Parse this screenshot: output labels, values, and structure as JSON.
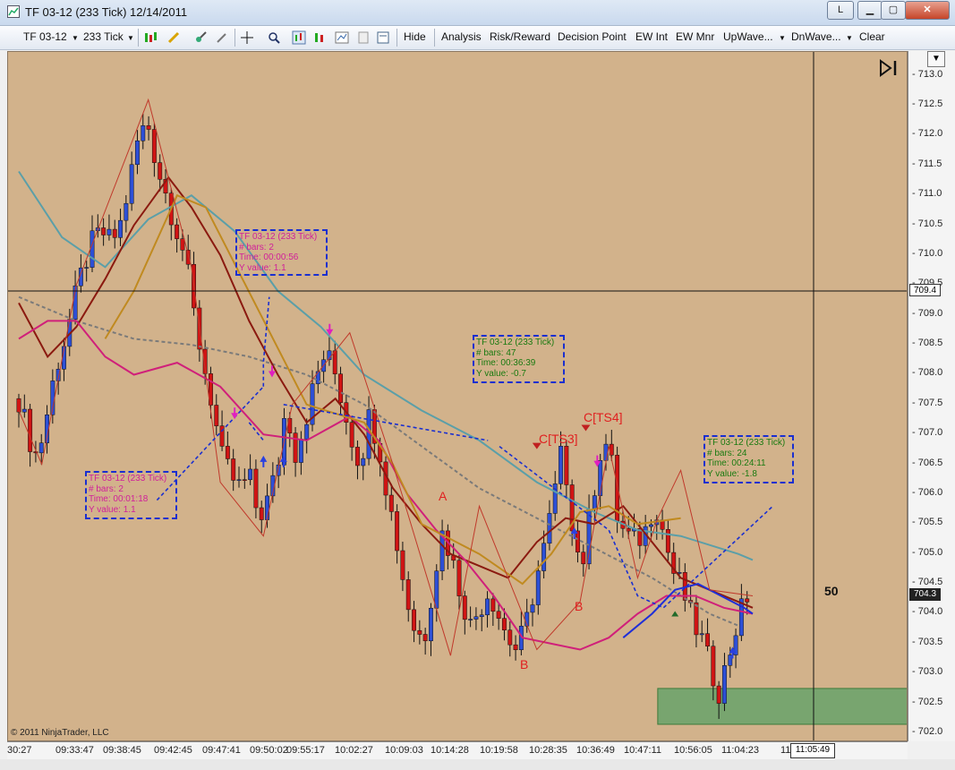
{
  "window": {
    "title": "TF 03-12 (233 Tick)  12/14/2011",
    "btn_l": "L"
  },
  "toolbar": {
    "instrument": "TF 03-12",
    "interval": "233 Tick",
    "items": [
      "Hide",
      "Analysis",
      "Risk/Reward",
      "Decision Point",
      "EW Int",
      "EW Mnr",
      "UpWave...",
      "DnWave...",
      "Clear"
    ]
  },
  "chart_data": {
    "type": "candlestick",
    "instrument": "TF 03-12 (233 Tick)",
    "date": "12/14/2011",
    "ylim": [
      701.85,
      713.4
    ],
    "y_ticks": [
      702.0,
      702.5,
      703.0,
      703.5,
      704.0,
      704.5,
      705.0,
      705.5,
      706.0,
      706.5,
      707.0,
      707.5,
      708.0,
      708.5,
      709.0,
      709.5,
      710.0,
      710.5,
      711.0,
      711.5,
      712.0,
      712.5,
      713.0
    ],
    "x_ticks": [
      "30:27",
      "09:33:47",
      "09:38:45",
      "09:42:45",
      "09:47:41",
      "09:50:02",
      "09:55:17",
      "10:02:27",
      "10:09:03",
      "10:14:28",
      "10:19:58",
      "10:28:35",
      "10:36:49",
      "10:47:11",
      "10:56:05",
      "11:04:23",
      "11:1"
    ],
    "close_path": [
      707.6,
      707.0,
      706.6,
      707.3,
      708.1,
      708.6,
      709.2,
      709.8,
      710.2,
      710.4,
      710.2,
      710.5,
      711.2,
      712.0,
      712.2,
      711.5,
      711.0,
      710.5,
      710.0,
      709.0,
      708.2,
      707.5,
      706.6,
      706.3,
      706.1,
      706.3,
      705.6,
      705.9,
      706.4,
      707.5,
      706.7,
      707.2,
      707.8,
      708.3,
      708.2,
      707.6,
      707.0,
      706.5,
      707.3,
      706.9,
      706.0,
      705.2,
      704.3,
      703.7,
      703.6,
      704.6,
      705.4,
      704.9,
      704.3,
      703.8,
      704.1,
      704.4,
      704.0,
      703.6,
      703.4,
      703.8,
      704.5,
      705.1,
      705.9,
      706.8,
      705.6,
      704.7,
      705.7,
      706.7,
      706.9,
      705.5,
      705.3,
      705.2,
      705.4,
      705.9,
      705.3,
      704.7,
      704.4,
      703.9,
      703.6,
      703.1,
      702.7,
      703.3,
      703.9,
      704.3
    ],
    "n_bars": 130,
    "last_price": "704.3",
    "crosshair_price": "709.4",
    "crosshair_time": "11:05:49",
    "crosshair_price_value": 709.4,
    "moving_averages": [
      {
        "color": "#5b9fa8",
        "points": [
          [
            0,
            711.4
          ],
          [
            15,
            710.3
          ],
          [
            30,
            709.8
          ],
          [
            45,
            710.6
          ],
          [
            60,
            711.0
          ],
          [
            75,
            710.4
          ],
          [
            90,
            709.4
          ],
          [
            105,
            708.8
          ],
          [
            120,
            708.0
          ],
          [
            140,
            707.4
          ],
          [
            160,
            706.9
          ],
          [
            180,
            706.2
          ],
          [
            200,
            705.7
          ],
          [
            215,
            705.4
          ],
          [
            230,
            705.3
          ],
          [
            250,
            705.0
          ],
          [
            255,
            704.9
          ]
        ]
      },
      {
        "color": "#7a7a7a",
        "dash": "4,3",
        "points": [
          [
            0,
            709.3
          ],
          [
            20,
            708.9
          ],
          [
            40,
            708.6
          ],
          [
            60,
            708.5
          ],
          [
            80,
            708.3
          ],
          [
            100,
            708.0
          ],
          [
            120,
            707.5
          ],
          [
            140,
            706.8
          ],
          [
            160,
            706.1
          ],
          [
            180,
            705.6
          ],
          [
            200,
            705.1
          ],
          [
            220,
            704.6
          ],
          [
            240,
            704.0
          ],
          [
            250,
            703.8
          ]
        ]
      },
      {
        "color": "#8b1a10",
        "points": [
          [
            0,
            709.2
          ],
          [
            10,
            708.3
          ],
          [
            20,
            708.8
          ],
          [
            30,
            709.6
          ],
          [
            40,
            710.5
          ],
          [
            52,
            711.3
          ],
          [
            60,
            710.8
          ],
          [
            70,
            710.0
          ],
          [
            80,
            708.9
          ],
          [
            90,
            708.0
          ],
          [
            100,
            707.2
          ],
          [
            110,
            707.6
          ],
          [
            120,
            707.0
          ],
          [
            130,
            706.1
          ],
          [
            140,
            705.5
          ],
          [
            150,
            705.0
          ],
          [
            160,
            704.8
          ],
          [
            170,
            704.6
          ],
          [
            180,
            705.2
          ],
          [
            190,
            705.6
          ],
          [
            200,
            705.5
          ],
          [
            210,
            705.8
          ],
          [
            220,
            705.2
          ],
          [
            230,
            704.6
          ],
          [
            240,
            704.4
          ],
          [
            255,
            704.1
          ]
        ]
      },
      {
        "color": "#d0207a",
        "points": [
          [
            0,
            708.6
          ],
          [
            10,
            708.9
          ],
          [
            20,
            708.9
          ],
          [
            30,
            708.3
          ],
          [
            40,
            708.0
          ],
          [
            55,
            708.2
          ],
          [
            70,
            707.8
          ],
          [
            85,
            707.0
          ],
          [
            100,
            706.9
          ],
          [
            115,
            707.3
          ],
          [
            125,
            706.9
          ],
          [
            135,
            706.0
          ],
          [
            145,
            705.4
          ],
          [
            155,
            704.9
          ],
          [
            165,
            704.3
          ],
          [
            175,
            703.6
          ],
          [
            185,
            703.5
          ],
          [
            195,
            703.4
          ],
          [
            205,
            703.6
          ],
          [
            215,
            704.0
          ],
          [
            225,
            704.3
          ],
          [
            235,
            704.3
          ],
          [
            245,
            704.1
          ],
          [
            255,
            704.0
          ]
        ]
      },
      {
        "color": "#1f2fd8",
        "points": [
          [
            210,
            703.6
          ],
          [
            220,
            704.0
          ],
          [
            228,
            704.4
          ],
          [
            236,
            704.5
          ],
          [
            244,
            704.3
          ],
          [
            252,
            704.1
          ],
          [
            255,
            704.0
          ]
        ]
      },
      {
        "color": "#c08a20",
        "points": [
          [
            30,
            708.6
          ],
          [
            40,
            709.4
          ],
          [
            55,
            711.0
          ],
          [
            65,
            710.8
          ],
          [
            100,
            707.5
          ],
          [
            120,
            707.2
          ],
          [
            130,
            706.5
          ],
          [
            140,
            705.5
          ],
          [
            160,
            705.0
          ],
          [
            175,
            704.5
          ],
          [
            185,
            705.0
          ],
          [
            195,
            705.7
          ],
          [
            205,
            705.8
          ],
          [
            215,
            705.5
          ],
          [
            230,
            705.6
          ]
        ]
      }
    ],
    "zigzag": [
      [
        0,
        707.4
      ],
      [
        8,
        706.5
      ],
      [
        20,
        709.5
      ],
      [
        45,
        712.6
      ],
      [
        60,
        709.8
      ],
      [
        70,
        706.2
      ],
      [
        85,
        705.3
      ],
      [
        95,
        707.5
      ],
      [
        115,
        708.7
      ],
      [
        130,
        706.5
      ],
      [
        150,
        703.3
      ],
      [
        160,
        705.8
      ],
      [
        180,
        703.4
      ],
      [
        195,
        704.2
      ],
      [
        205,
        706.8
      ],
      [
        215,
        704.6
      ],
      [
        222,
        705.6
      ],
      [
        230,
        706.4
      ],
      [
        240,
        704.4
      ],
      [
        255,
        704.3
      ]
    ],
    "shaded_zone": {
      "from": 702.75,
      "to": 702.15,
      "start_bar": 222,
      "color": "#6ea36b"
    },
    "dashed_lines": [
      [
        [
          48,
          705.9
        ],
        [
          85,
          707.8
        ]
      ],
      [
        [
          80,
          707.2
        ],
        [
          85,
          706.9
        ]
      ],
      [
        [
          92,
          707.5
        ],
        [
          163,
          706.9
        ]
      ],
      [
        [
          167,
          706.8
        ],
        [
          205,
          705.4
        ],
        [
          215,
          704.3
        ],
        [
          224,
          704.1
        ],
        [
          262,
          705.8
        ]
      ],
      [
        [
          85,
          707.8
        ],
        [
          85,
          708.2
        ],
        [
          87,
          709.3
        ]
      ]
    ],
    "annotations": [
      {
        "color": "#d0209a",
        "lines": [
          "TF 03-12 (233 Tick)",
          "# bars:   2",
          "Time:     00:00:56",
          "Y value: 1.1"
        ]
      },
      {
        "color": "#1a7a10",
        "lines": [
          "TF 03-12 (233 Tick)",
          "# bars:   47",
          "Time:     00:36:39",
          "Y value: -0.7"
        ]
      },
      {
        "color": "#1a7a10",
        "lines": [
          "TF 03-12 (233 Tick)",
          "# bars:   24",
          "Time:     00:24:11",
          "Y value: -1.8"
        ]
      },
      {
        "color": "#d0209a",
        "lines": [
          "TF 03-12 (233 Tick)",
          "# bars:   2",
          "Time:     00:01:18",
          "Y value: 1.1"
        ]
      }
    ],
    "pattern_labels": [
      "A",
      "B",
      "B",
      "C[TS3]",
      "C[TS4]"
    ],
    "count_label": "50"
  },
  "copyright": "© 2011 NinjaTrader, LLC"
}
